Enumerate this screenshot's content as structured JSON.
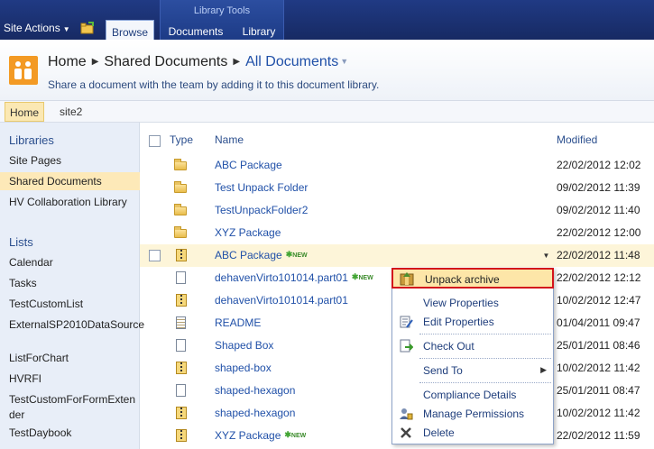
{
  "ribbon": {
    "site_actions": "Site Actions",
    "context_group": "Library Tools",
    "tabs": [
      "Browse",
      "Documents",
      "Library"
    ]
  },
  "title": {
    "home": "Home",
    "library": "Shared Documents",
    "view": "All Documents",
    "subtitle": "Share a document with the team by adding it to this document library."
  },
  "topnav": {
    "home": "Home",
    "site2": "site2"
  },
  "quicklaunch": {
    "libraries_heading": "Libraries",
    "libraries": [
      "Site Pages",
      "Shared Documents",
      "HV Collaboration Library"
    ],
    "lists_heading": "Lists",
    "lists": [
      "Calendar",
      "Tasks",
      "TestCustomList",
      "ExternalSP2010DataSource",
      "ListForChart",
      "HVRFI",
      "TestCustomForFormExtender",
      "TestDaybook"
    ]
  },
  "list": {
    "headers": {
      "type": "Type",
      "name": "Name",
      "modified": "Modified"
    },
    "new_tag": "NEW",
    "rows": [
      {
        "icon": "folder-icon",
        "name": "ABC Package",
        "modified": "22/02/2012 12:02"
      },
      {
        "icon": "folder-icon",
        "name": "Test Unpack Folder",
        "modified": "09/02/2012 11:39"
      },
      {
        "icon": "folder-icon",
        "name": "TestUnpackFolder2",
        "modified": "09/02/2012 11:40"
      },
      {
        "icon": "folder-icon",
        "name": "XYZ Package",
        "modified": "22/02/2012 12:00"
      },
      {
        "icon": "zip-icon",
        "name": "ABC Package",
        "modified": "22/02/2012 11:48"
      },
      {
        "icon": "document-icon",
        "name": "dehavenVirto101014.part01",
        "modified": "22/02/2012 12:12"
      },
      {
        "icon": "zip-icon",
        "name": "dehavenVirto101014.part01",
        "modified": "10/02/2012 12:47"
      },
      {
        "icon": "text-file-icon",
        "name": "README",
        "modified": "01/04/2011 09:47"
      },
      {
        "icon": "document-icon",
        "name": "Shaped Box",
        "modified": "25/01/2011 08:46"
      },
      {
        "icon": "zip-icon",
        "name": "shaped-box",
        "modified": "10/02/2012 11:42"
      },
      {
        "icon": "document-icon",
        "name": "shaped-hexagon",
        "modified": "25/01/2011 08:47"
      },
      {
        "icon": "zip-icon",
        "name": "shaped-hexagon",
        "modified": "10/02/2012 11:42"
      },
      {
        "icon": "zip-icon",
        "name": "XYZ Package",
        "modified": "22/02/2012 11:59"
      }
    ]
  },
  "context_menu": {
    "unpack": "Unpack archive",
    "view_properties": "View Properties",
    "edit_properties": "Edit Properties",
    "check_out": "Check Out",
    "send_to": "Send To",
    "compliance": "Compliance Details",
    "permissions": "Manage Permissions",
    "delete": "Delete"
  }
}
